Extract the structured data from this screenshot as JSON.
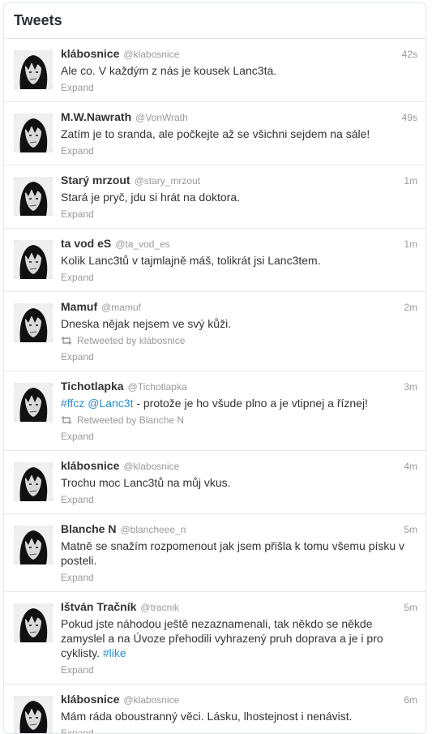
{
  "panel": {
    "title": "Tweets"
  },
  "tweets": [
    {
      "fullname": "klábosnice",
      "username": "@klabosnice",
      "time": "42s",
      "segments": [
        {
          "t": "Ale co. V každým z nás je kousek Lanc3ta.",
          "link": false
        }
      ],
      "retweeted_by": null,
      "expand": "Expand"
    },
    {
      "fullname": "M.W.Nawrath",
      "username": "@VonWrath",
      "time": "49s",
      "segments": [
        {
          "t": "Zatím je to sranda, ale počkejte až se všichni sejdem na sále!",
          "link": false
        }
      ],
      "retweeted_by": null,
      "expand": "Expand"
    },
    {
      "fullname": "Starý mrzout",
      "username": "@stary_mrzout",
      "time": "1m",
      "segments": [
        {
          "t": "Stará je pryč, jdu si hrát na doktora.",
          "link": false
        }
      ],
      "retweeted_by": null,
      "expand": "Expand"
    },
    {
      "fullname": "ta vod eS",
      "username": "@ta_vod_es",
      "time": "1m",
      "segments": [
        {
          "t": "Kolik Lanc3tů v tajmlajně máš, tolikrát jsi Lanc3tem.",
          "link": false
        }
      ],
      "retweeted_by": null,
      "expand": "Expand"
    },
    {
      "fullname": "Mamuf",
      "username": "@mamuf",
      "time": "2m",
      "segments": [
        {
          "t": "Dneska nějak nejsem ve svý kůži.",
          "link": false
        }
      ],
      "retweeted_by": "Retweeted by klábosnice",
      "expand": "Expand"
    },
    {
      "fullname": "Tichotlapka",
      "username": "@Tichotlapka",
      "time": "3m",
      "segments": [
        {
          "t": "#ffcz",
          "link": true
        },
        {
          "t": " ",
          "link": false
        },
        {
          "t": "@Lanc3t",
          "link": true
        },
        {
          "t": " - protože je ho všude plno a je vtipnej a říznej!",
          "link": false
        }
      ],
      "retweeted_by": "Retweeted by Blanche N",
      "expand": "Expand"
    },
    {
      "fullname": "klábosnice",
      "username": "@klabosnice",
      "time": "4m",
      "segments": [
        {
          "t": "Trochu moc Lanc3tů na můj vkus.",
          "link": false
        }
      ],
      "retweeted_by": null,
      "expand": "Expand"
    },
    {
      "fullname": "Blanche N",
      "username": "@blancheee_n",
      "time": "5m",
      "segments": [
        {
          "t": "Matně se snažím rozpomenout jak jsem přišla k tomu všemu písku v posteli.",
          "link": false
        }
      ],
      "retweeted_by": null,
      "expand": "Expand"
    },
    {
      "fullname": "Ištván Tračník",
      "username": "@tracnik",
      "time": "5m",
      "segments": [
        {
          "t": "Pokud jste náhodou ještě nezaznamenali, tak někdo se někde zamyslel a na Úvoze přehodili vyhrazený pruh doprava a je i pro cyklisty. ",
          "link": false
        },
        {
          "t": "#like",
          "link": true
        }
      ],
      "retweeted_by": null,
      "expand": "Expand"
    },
    {
      "fullname": "klábosnice",
      "username": "@klabosnice",
      "time": "6m",
      "segments": [
        {
          "t": "Mám ráda oboustranný věci. Lásku, lhostejnost i nenávist.",
          "link": false
        }
      ],
      "retweeted_by": null,
      "expand": "Expand"
    }
  ],
  "colors": {
    "link": "#2a8ec6",
    "meta": "#999999",
    "border": "#e1e8ed"
  },
  "icons": {
    "avatar": "avatar-image",
    "retweet": "retweet-icon"
  }
}
